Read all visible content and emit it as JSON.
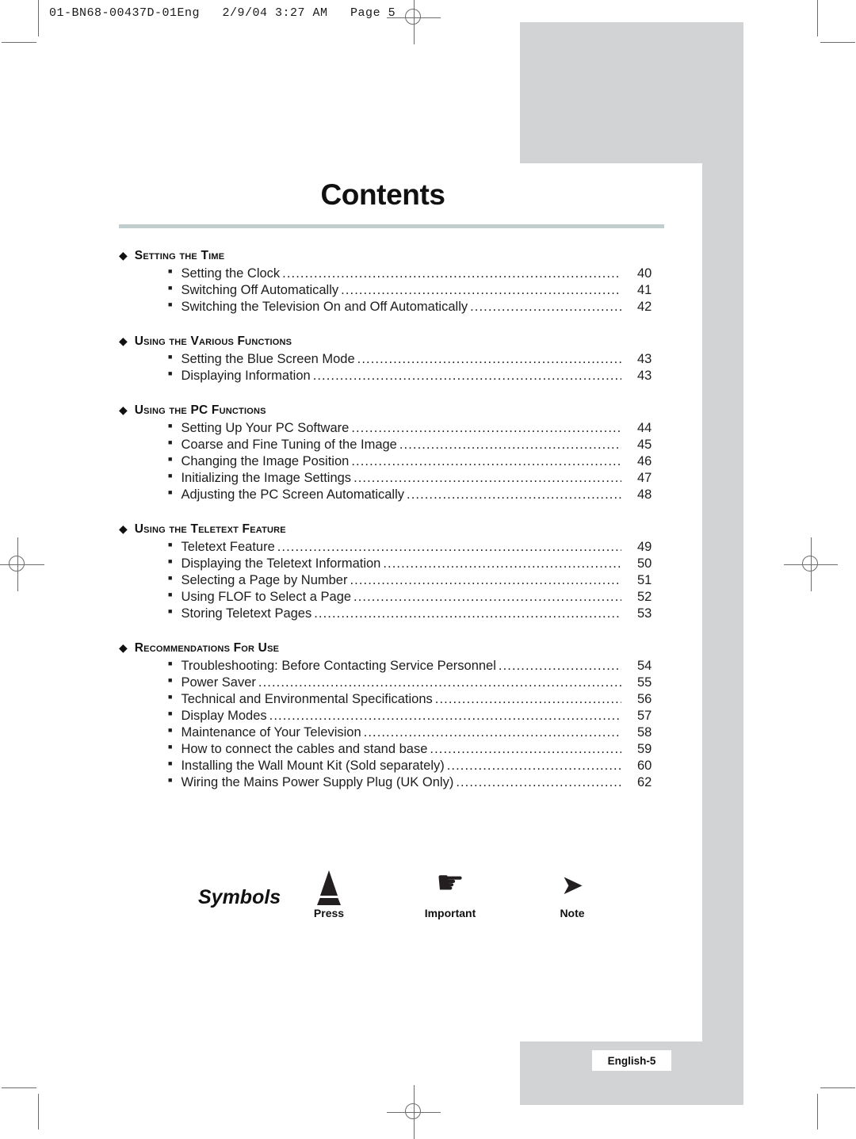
{
  "file_header": "01-BN68-00437D-01Eng   2/9/04 3:27 AM   Page 5",
  "page_title": "Contents",
  "sections": [
    {
      "heading": "Setting the Time",
      "entries": [
        {
          "label": "Setting the Clock",
          "page": "40"
        },
        {
          "label": "Switching Off Automatically",
          "page": "41"
        },
        {
          "label": "Switching the Television On and Off Automatically",
          "page": "42"
        }
      ]
    },
    {
      "heading": "Using the Various Functions",
      "entries": [
        {
          "label": "Setting the Blue Screen Mode",
          "page": "43"
        },
        {
          "label": "Displaying Information",
          "page": "43"
        }
      ]
    },
    {
      "heading": "Using the PC Functions",
      "entries": [
        {
          "label": "Setting Up Your PC Software",
          "page": "44"
        },
        {
          "label": "Coarse and Fine Tuning of the Image",
          "page": "45"
        },
        {
          "label": "Changing the Image Position",
          "page": "46"
        },
        {
          "label": "Initializing the Image Settings",
          "page": "47"
        },
        {
          "label": "Adjusting the PC Screen Automatically",
          "page": "48"
        }
      ]
    },
    {
      "heading": "Using the Teletext Feature",
      "entries": [
        {
          "label": "Teletext Feature",
          "page": "49"
        },
        {
          "label": "Displaying the Teletext Information",
          "page": "50"
        },
        {
          "label": "Selecting a Page by Number",
          "page": "51"
        },
        {
          "label": "Using FLOF to Select a Page",
          "page": "52"
        },
        {
          "label": "Storing Teletext Pages",
          "page": "53"
        }
      ]
    },
    {
      "heading": "Recommendations For Use",
      "entries": [
        {
          "label": "Troubleshooting: Before Contacting Service Personnel",
          "page": "54"
        },
        {
          "label": "Power Saver",
          "page": "55"
        },
        {
          "label": "Technical and Environmental Specifications",
          "page": "56"
        },
        {
          "label": "Display Modes",
          "page": "57"
        },
        {
          "label": "Maintenance of Your Television",
          "page": "58"
        },
        {
          "label": "How to connect the cables and stand base",
          "page": "59"
        },
        {
          "label": "Installing the Wall Mount Kit (Sold separately)",
          "page": "60"
        },
        {
          "label": "Wiring the Mains Power Supply Plug (UK Only)",
          "page": "62"
        }
      ]
    }
  ],
  "symbols": {
    "label": "Symbols",
    "items": [
      {
        "icon": "press-triangle-icon",
        "caption": "Press"
      },
      {
        "icon": "pointing-hand-icon",
        "caption": "Important",
        "glyph": "☛"
      },
      {
        "icon": "note-arrow-icon",
        "caption": "Note",
        "glyph": "➤"
      }
    ]
  },
  "footer": {
    "page_badge": "English-5"
  },
  "bullets": {
    "section_marker": "◆",
    "entry_marker": "■",
    "leader_char": "."
  },
  "colors": {
    "gray_block": "#d2d3d4",
    "title_rule": "#c2cdcd",
    "text": "#1a1a1a",
    "crop_mark": "#6d6d6d"
  }
}
